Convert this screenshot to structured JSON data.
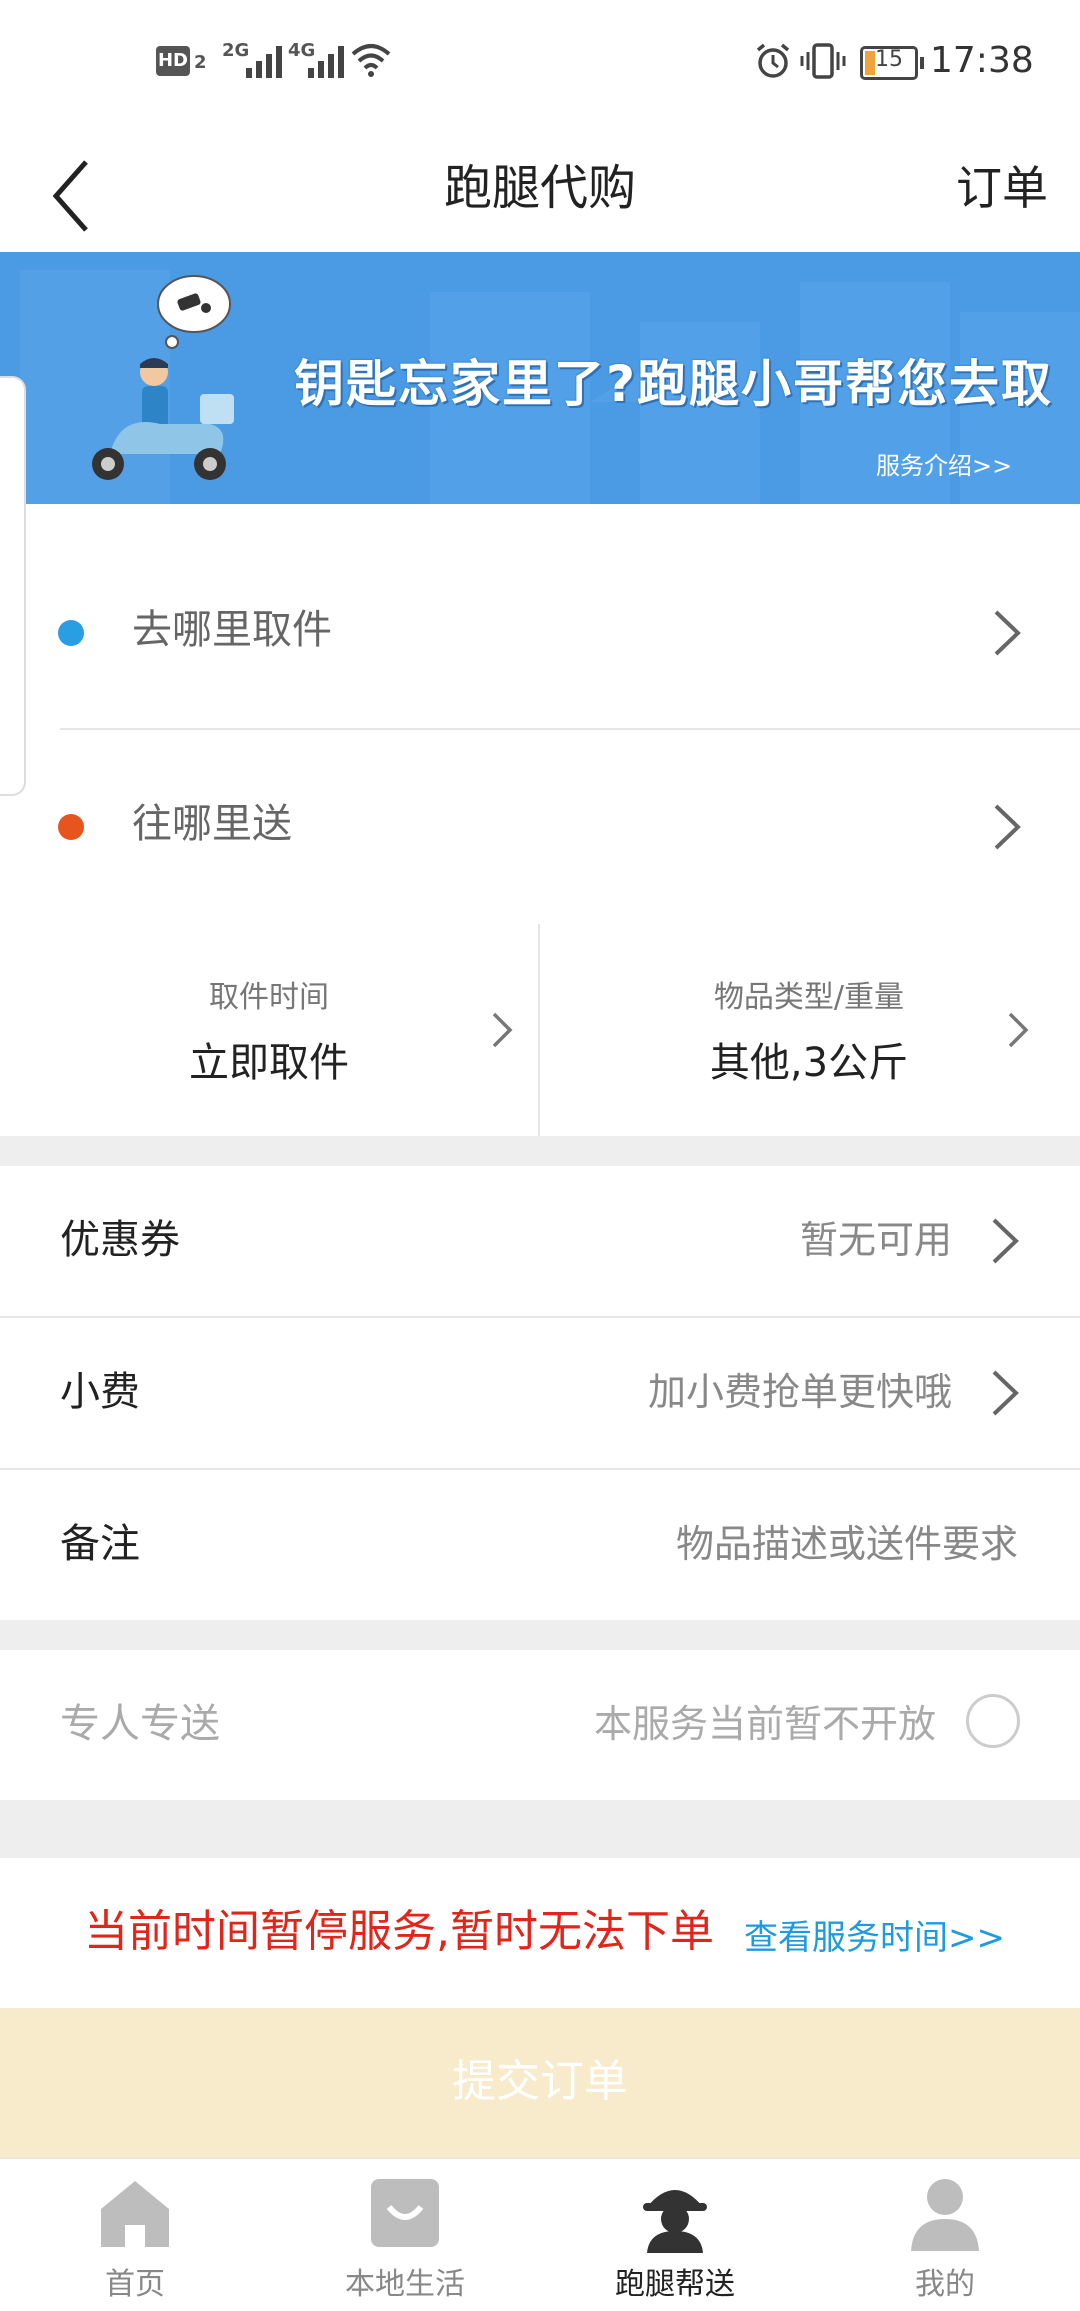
{
  "status_bar": {
    "network_badge": "HD",
    "network_badge_sub": "2",
    "signal1_label": "2G",
    "signal2_label": "4G",
    "battery": "15",
    "time": "17:38"
  },
  "header": {
    "title": "跑腿代购",
    "orders_label": "订单"
  },
  "banner": {
    "headline": "钥匙忘家里了?跑腿小哥帮您去取",
    "link": "服务介绍>>"
  },
  "address": {
    "pickup_placeholder": "去哪里取件",
    "pickup_dot_color": "#2a9ee3",
    "deliver_placeholder": "往哪里送",
    "deliver_dot_color": "#e8541d"
  },
  "options": {
    "time_label": "取件时间",
    "time_value": "立即取件",
    "goods_label": "物品类型/重量",
    "goods_value": "其他,3公斤"
  },
  "form": {
    "coupon_label": "优惠券",
    "coupon_value": "暂无可用",
    "tip_label": "小费",
    "tip_value": "加小费抢单更快哦",
    "note_label": "备注",
    "note_placeholder": "物品描述或送件要求",
    "dedicated_label": "专人专送",
    "dedicated_value": "本服务当前暂不开放"
  },
  "notice": {
    "text": "当前时间暂停服务,暂时无法下单",
    "link": "查看服务时间>>"
  },
  "submit": {
    "label": "提交订单"
  },
  "tabbar": {
    "items": [
      {
        "label": "首页",
        "icon": "home-icon"
      },
      {
        "label": "本地生活",
        "icon": "shopping-bag-icon"
      },
      {
        "label": "跑腿帮送",
        "icon": "courier-icon",
        "active": true
      },
      {
        "label": "我的",
        "icon": "person-icon"
      }
    ]
  },
  "colors": {
    "banner": "#4b9ae4",
    "notice_red": "#e1251b",
    "link_blue": "#1d9ae0",
    "submit_disabled": "#f8ebcc"
  }
}
